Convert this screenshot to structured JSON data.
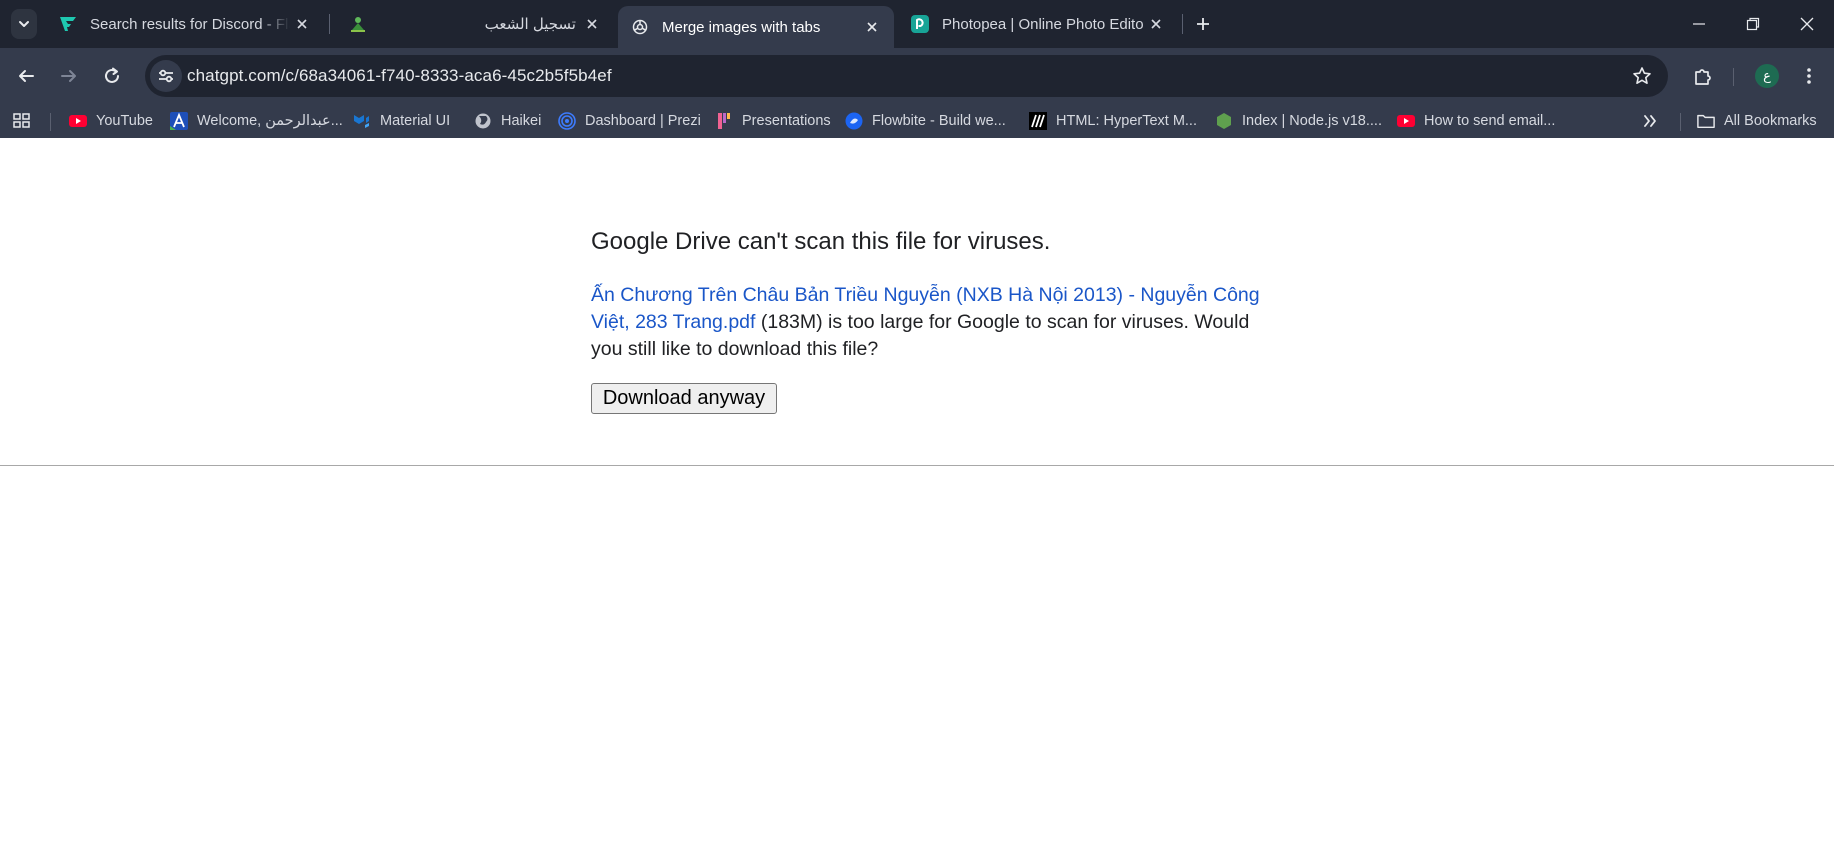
{
  "tabs": [
    {
      "title": "Search results for Discord - Flaticon",
      "active": false
    },
    {
      "title": "تسجيل الشعب",
      "active": false
    },
    {
      "title": "Merge images with tabs",
      "active": true
    },
    {
      "title": "Photopea | Online Photo Editor",
      "active": false
    }
  ],
  "address_bar": {
    "url": "chatgpt.com/c/68a34061-f740-8333-aca6-45c2b5f5b4ef"
  },
  "profile": {
    "initial": "ع"
  },
  "bookmarks": [
    {
      "label": "YouTube",
      "icon": "youtube-icon"
    },
    {
      "label": "Welcome, عبدالرحمن...",
      "icon": "app-a-icon"
    },
    {
      "label": "Material UI",
      "icon": "mui-icon"
    },
    {
      "label": "Haikei",
      "icon": "globe-icon"
    },
    {
      "label": "Dashboard | Prezi",
      "icon": "prezi-icon"
    },
    {
      "label": "Presentations",
      "icon": "pitch-icon"
    },
    {
      "label": "Flowbite - Build we...",
      "icon": "flowbite-icon"
    },
    {
      "label": "HTML: HyperText M...",
      "icon": "mdn-icon"
    },
    {
      "label": "Index | Node.js v18....",
      "icon": "nodejs-icon"
    },
    {
      "label": "How to send email...",
      "icon": "youtube-icon"
    }
  ],
  "all_bookmarks_label": "All Bookmarks",
  "page": {
    "heading": "Google Drive can't scan this file for viruses.",
    "file_name": "Ấn Chương Trên Châu Bản Triều Nguyễn (NXB Hà Nội 2013) - Nguyễn Công Việt, 283 Trang.pdf",
    "message_rest": " (183M) is too large for Google to scan for viruses. Would you still like to download this file?",
    "download_button": "Download anyway"
  },
  "colors": {
    "tab_strip": "#1f2430",
    "toolbar": "#343b4c",
    "link": "#1a56c8"
  }
}
